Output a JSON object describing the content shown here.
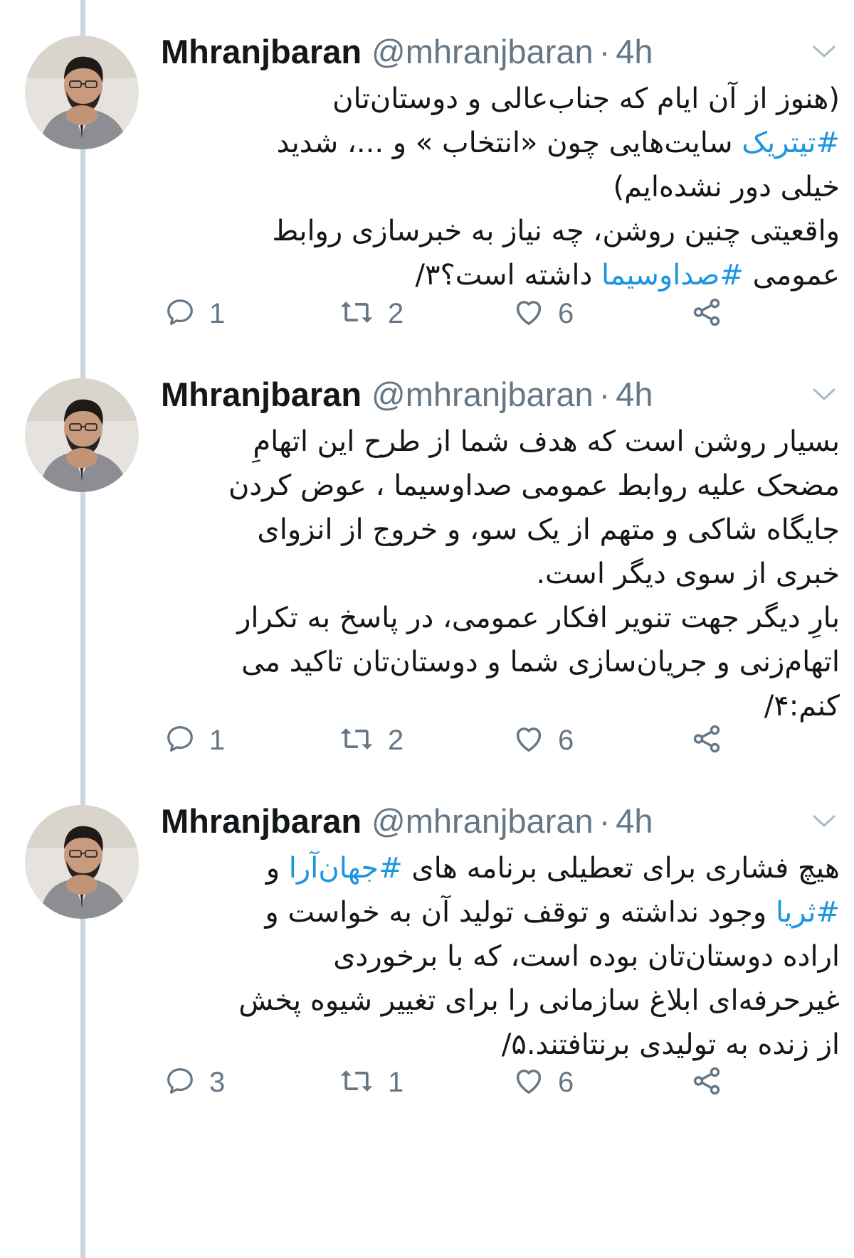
{
  "tweets": [
    {
      "author": {
        "name": "Mhranjbaran",
        "handle": "@mhranjbaran",
        "separator": "·",
        "time": "4h"
      },
      "lines": [
        [
          {
            "t": "(هنوز از آن ایام که جناب‌عالی و دوستان‌تان"
          }
        ],
        [
          {
            "t": "#تیتریک",
            "tag": true
          },
          {
            "t": " سایت‌هایی چون «انتخاب » و ...، شدید"
          }
        ],
        [
          {
            "t": "خیلی دور نشده‌ایم)"
          }
        ],
        [
          {
            "t": "واقعیتی چنین روشن، چه نیاز به خبرسازی روابط"
          }
        ],
        [
          {
            "t": "عمومی "
          },
          {
            "t": "#صداوسیما",
            "tag": true
          },
          {
            "t": " داشته است؟۳/"
          }
        ]
      ],
      "stats": {
        "replies": "1",
        "retweets": "2",
        "likes": "6"
      }
    },
    {
      "author": {
        "name": "Mhranjbaran",
        "handle": "@mhranjbaran",
        "separator": "·",
        "time": "4h"
      },
      "lines": [
        [
          {
            "t": "بسیار روشن است که هدف شما از طرح این اتهامِ"
          }
        ],
        [
          {
            "t": "مضحک علیه روابط عمومی صداوسیما ، عوض کردن"
          }
        ],
        [
          {
            "t": "جایگاه شاکی و متهم از یک سو، و خروج از انزوای"
          }
        ],
        [
          {
            "t": "خبری از سوی دیگر است."
          }
        ],
        [
          {
            "t": "بارِ دیگر جهت تنویر افکار عمومی، در پاسخ به تکرار"
          }
        ],
        [
          {
            "t": "اتهام‌زنی و جریان‌سازی شما و دوستان‌تان تاکید می"
          }
        ],
        [
          {
            "t": "کنم:۴/"
          }
        ]
      ],
      "stats": {
        "replies": "1",
        "retweets": "2",
        "likes": "6"
      }
    },
    {
      "author": {
        "name": "Mhranjbaran",
        "handle": "@mhranjbaran",
        "separator": "·",
        "time": "4h"
      },
      "lines": [
        [
          {
            "t": "هیچ فشاری برای تعطیلی برنامه های "
          },
          {
            "t": "#جهان‌آرا",
            "tag": true
          },
          {
            "t": " و"
          }
        ],
        [
          {
            "t": "#ثریا",
            "tag": true
          },
          {
            "t": " وجود نداشته و توقف تولید آن به خواست و"
          }
        ],
        [
          {
            "t": "اراده دوستان‌تان بوده است، که با برخوردی"
          }
        ],
        [
          {
            "t": "غیرحرفه‌ای ابلاغ سازمانی را برای تغییر شیوه پخش"
          }
        ],
        [
          {
            "t": "از زنده به تولیدی برنتافتند.۵/"
          }
        ]
      ],
      "stats": {
        "replies": "3",
        "retweets": "1",
        "likes": "6"
      }
    }
  ],
  "colors": {
    "hashtag": "#1b95e0",
    "meta": "#657786",
    "text": "#14171a",
    "thread_line": "#ccd6dd"
  },
  "icons": {
    "reply": "reply-icon",
    "retweet": "retweet-icon",
    "like": "heart-icon",
    "share": "share-icon",
    "menu": "chevron-down-icon"
  }
}
